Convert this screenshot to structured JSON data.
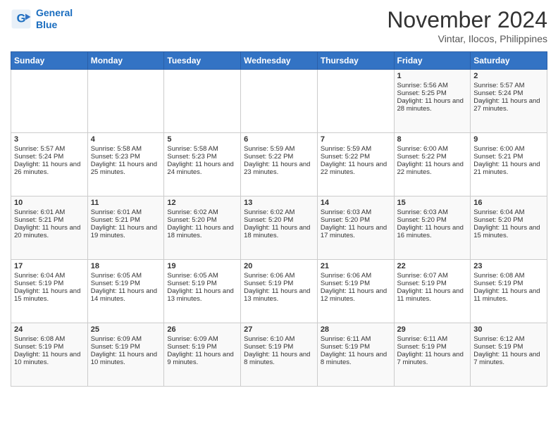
{
  "header": {
    "logo_line1": "General",
    "logo_line2": "Blue",
    "month": "November 2024",
    "location": "Vintar, Ilocos, Philippines"
  },
  "days_of_week": [
    "Sunday",
    "Monday",
    "Tuesday",
    "Wednesday",
    "Thursday",
    "Friday",
    "Saturday"
  ],
  "weeks": [
    [
      {
        "day": "",
        "empty": true
      },
      {
        "day": "",
        "empty": true
      },
      {
        "day": "",
        "empty": true
      },
      {
        "day": "",
        "empty": true
      },
      {
        "day": "",
        "empty": true
      },
      {
        "day": "1",
        "sunrise": "Sunrise: 5:56 AM",
        "sunset": "Sunset: 5:25 PM",
        "daylight": "Daylight: 11 hours and 28 minutes."
      },
      {
        "day": "2",
        "sunrise": "Sunrise: 5:57 AM",
        "sunset": "Sunset: 5:24 PM",
        "daylight": "Daylight: 11 hours and 27 minutes."
      }
    ],
    [
      {
        "day": "3",
        "sunrise": "Sunrise: 5:57 AM",
        "sunset": "Sunset: 5:24 PM",
        "daylight": "Daylight: 11 hours and 26 minutes."
      },
      {
        "day": "4",
        "sunrise": "Sunrise: 5:58 AM",
        "sunset": "Sunset: 5:23 PM",
        "daylight": "Daylight: 11 hours and 25 minutes."
      },
      {
        "day": "5",
        "sunrise": "Sunrise: 5:58 AM",
        "sunset": "Sunset: 5:23 PM",
        "daylight": "Daylight: 11 hours and 24 minutes."
      },
      {
        "day": "6",
        "sunrise": "Sunrise: 5:59 AM",
        "sunset": "Sunset: 5:22 PM",
        "daylight": "Daylight: 11 hours and 23 minutes."
      },
      {
        "day": "7",
        "sunrise": "Sunrise: 5:59 AM",
        "sunset": "Sunset: 5:22 PM",
        "daylight": "Daylight: 11 hours and 22 minutes."
      },
      {
        "day": "8",
        "sunrise": "Sunrise: 6:00 AM",
        "sunset": "Sunset: 5:22 PM",
        "daylight": "Daylight: 11 hours and 22 minutes."
      },
      {
        "day": "9",
        "sunrise": "Sunrise: 6:00 AM",
        "sunset": "Sunset: 5:21 PM",
        "daylight": "Daylight: 11 hours and 21 minutes."
      }
    ],
    [
      {
        "day": "10",
        "sunrise": "Sunrise: 6:01 AM",
        "sunset": "Sunset: 5:21 PM",
        "daylight": "Daylight: 11 hours and 20 minutes."
      },
      {
        "day": "11",
        "sunrise": "Sunrise: 6:01 AM",
        "sunset": "Sunset: 5:21 PM",
        "daylight": "Daylight: 11 hours and 19 minutes."
      },
      {
        "day": "12",
        "sunrise": "Sunrise: 6:02 AM",
        "sunset": "Sunset: 5:20 PM",
        "daylight": "Daylight: 11 hours and 18 minutes."
      },
      {
        "day": "13",
        "sunrise": "Sunrise: 6:02 AM",
        "sunset": "Sunset: 5:20 PM",
        "daylight": "Daylight: 11 hours and 18 minutes."
      },
      {
        "day": "14",
        "sunrise": "Sunrise: 6:03 AM",
        "sunset": "Sunset: 5:20 PM",
        "daylight": "Daylight: 11 hours and 17 minutes."
      },
      {
        "day": "15",
        "sunrise": "Sunrise: 6:03 AM",
        "sunset": "Sunset: 5:20 PM",
        "daylight": "Daylight: 11 hours and 16 minutes."
      },
      {
        "day": "16",
        "sunrise": "Sunrise: 6:04 AM",
        "sunset": "Sunset: 5:20 PM",
        "daylight": "Daylight: 11 hours and 15 minutes."
      }
    ],
    [
      {
        "day": "17",
        "sunrise": "Sunrise: 6:04 AM",
        "sunset": "Sunset: 5:19 PM",
        "daylight": "Daylight: 11 hours and 15 minutes."
      },
      {
        "day": "18",
        "sunrise": "Sunrise: 6:05 AM",
        "sunset": "Sunset: 5:19 PM",
        "daylight": "Daylight: 11 hours and 14 minutes."
      },
      {
        "day": "19",
        "sunrise": "Sunrise: 6:05 AM",
        "sunset": "Sunset: 5:19 PM",
        "daylight": "Daylight: 11 hours and 13 minutes."
      },
      {
        "day": "20",
        "sunrise": "Sunrise: 6:06 AM",
        "sunset": "Sunset: 5:19 PM",
        "daylight": "Daylight: 11 hours and 13 minutes."
      },
      {
        "day": "21",
        "sunrise": "Sunrise: 6:06 AM",
        "sunset": "Sunset: 5:19 PM",
        "daylight": "Daylight: 11 hours and 12 minutes."
      },
      {
        "day": "22",
        "sunrise": "Sunrise: 6:07 AM",
        "sunset": "Sunset: 5:19 PM",
        "daylight": "Daylight: 11 hours and 11 minutes."
      },
      {
        "day": "23",
        "sunrise": "Sunrise: 6:08 AM",
        "sunset": "Sunset: 5:19 PM",
        "daylight": "Daylight: 11 hours and 11 minutes."
      }
    ],
    [
      {
        "day": "24",
        "sunrise": "Sunrise: 6:08 AM",
        "sunset": "Sunset: 5:19 PM",
        "daylight": "Daylight: 11 hours and 10 minutes."
      },
      {
        "day": "25",
        "sunrise": "Sunrise: 6:09 AM",
        "sunset": "Sunset: 5:19 PM",
        "daylight": "Daylight: 11 hours and 10 minutes."
      },
      {
        "day": "26",
        "sunrise": "Sunrise: 6:09 AM",
        "sunset": "Sunset: 5:19 PM",
        "daylight": "Daylight: 11 hours and 9 minutes."
      },
      {
        "day": "27",
        "sunrise": "Sunrise: 6:10 AM",
        "sunset": "Sunset: 5:19 PM",
        "daylight": "Daylight: 11 hours and 8 minutes."
      },
      {
        "day": "28",
        "sunrise": "Sunrise: 6:11 AM",
        "sunset": "Sunset: 5:19 PM",
        "daylight": "Daylight: 11 hours and 8 minutes."
      },
      {
        "day": "29",
        "sunrise": "Sunrise: 6:11 AM",
        "sunset": "Sunset: 5:19 PM",
        "daylight": "Daylight: 11 hours and 7 minutes."
      },
      {
        "day": "30",
        "sunrise": "Sunrise: 6:12 AM",
        "sunset": "Sunset: 5:19 PM",
        "daylight": "Daylight: 11 hours and 7 minutes."
      }
    ]
  ]
}
